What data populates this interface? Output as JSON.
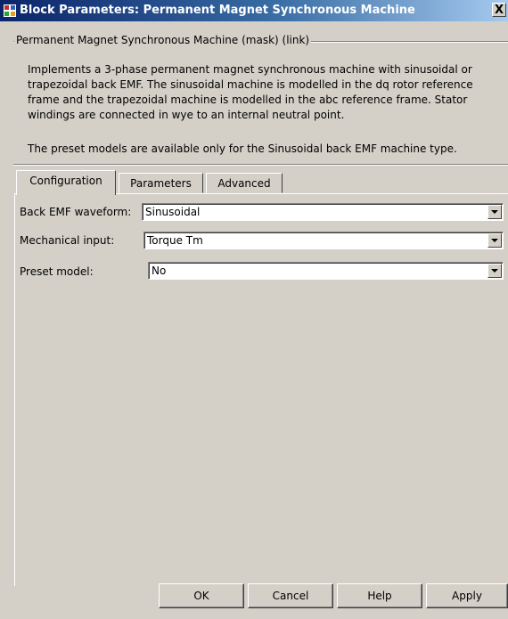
{
  "window": {
    "title": "Block Parameters: Permanent Magnet Synchronous Machine",
    "close_label": "X"
  },
  "group": {
    "legend": "Permanent Magnet Synchronous Machine (mask) (link)",
    "description": "Implements a 3-phase permanent magnet synchronous machine with sinusoidal or\ntrapezoidal back EMF. The sinusoidal machine is modelled in the dq rotor reference\nframe and the trapezoidal machine is modelled in the abc reference frame. Stator\nwindings are connected in wye to an internal neutral point.",
    "preset_note": "The preset models are available only for the Sinusoidal back EMF machine type."
  },
  "tabs": [
    {
      "label": "Configuration",
      "active": true
    },
    {
      "label": "Parameters",
      "active": false
    },
    {
      "label": "Advanced",
      "active": false
    }
  ],
  "fields": {
    "back_emf": {
      "label": "Back EMF waveform:",
      "value": "Sinusoidal"
    },
    "mech_input": {
      "label": "Mechanical input:",
      "value": "Torque Tm"
    },
    "preset_model": {
      "label": "Preset model:",
      "value": "No"
    }
  },
  "buttons": {
    "ok": "OK",
    "cancel": "Cancel",
    "help": "Help",
    "apply": "Apply"
  }
}
